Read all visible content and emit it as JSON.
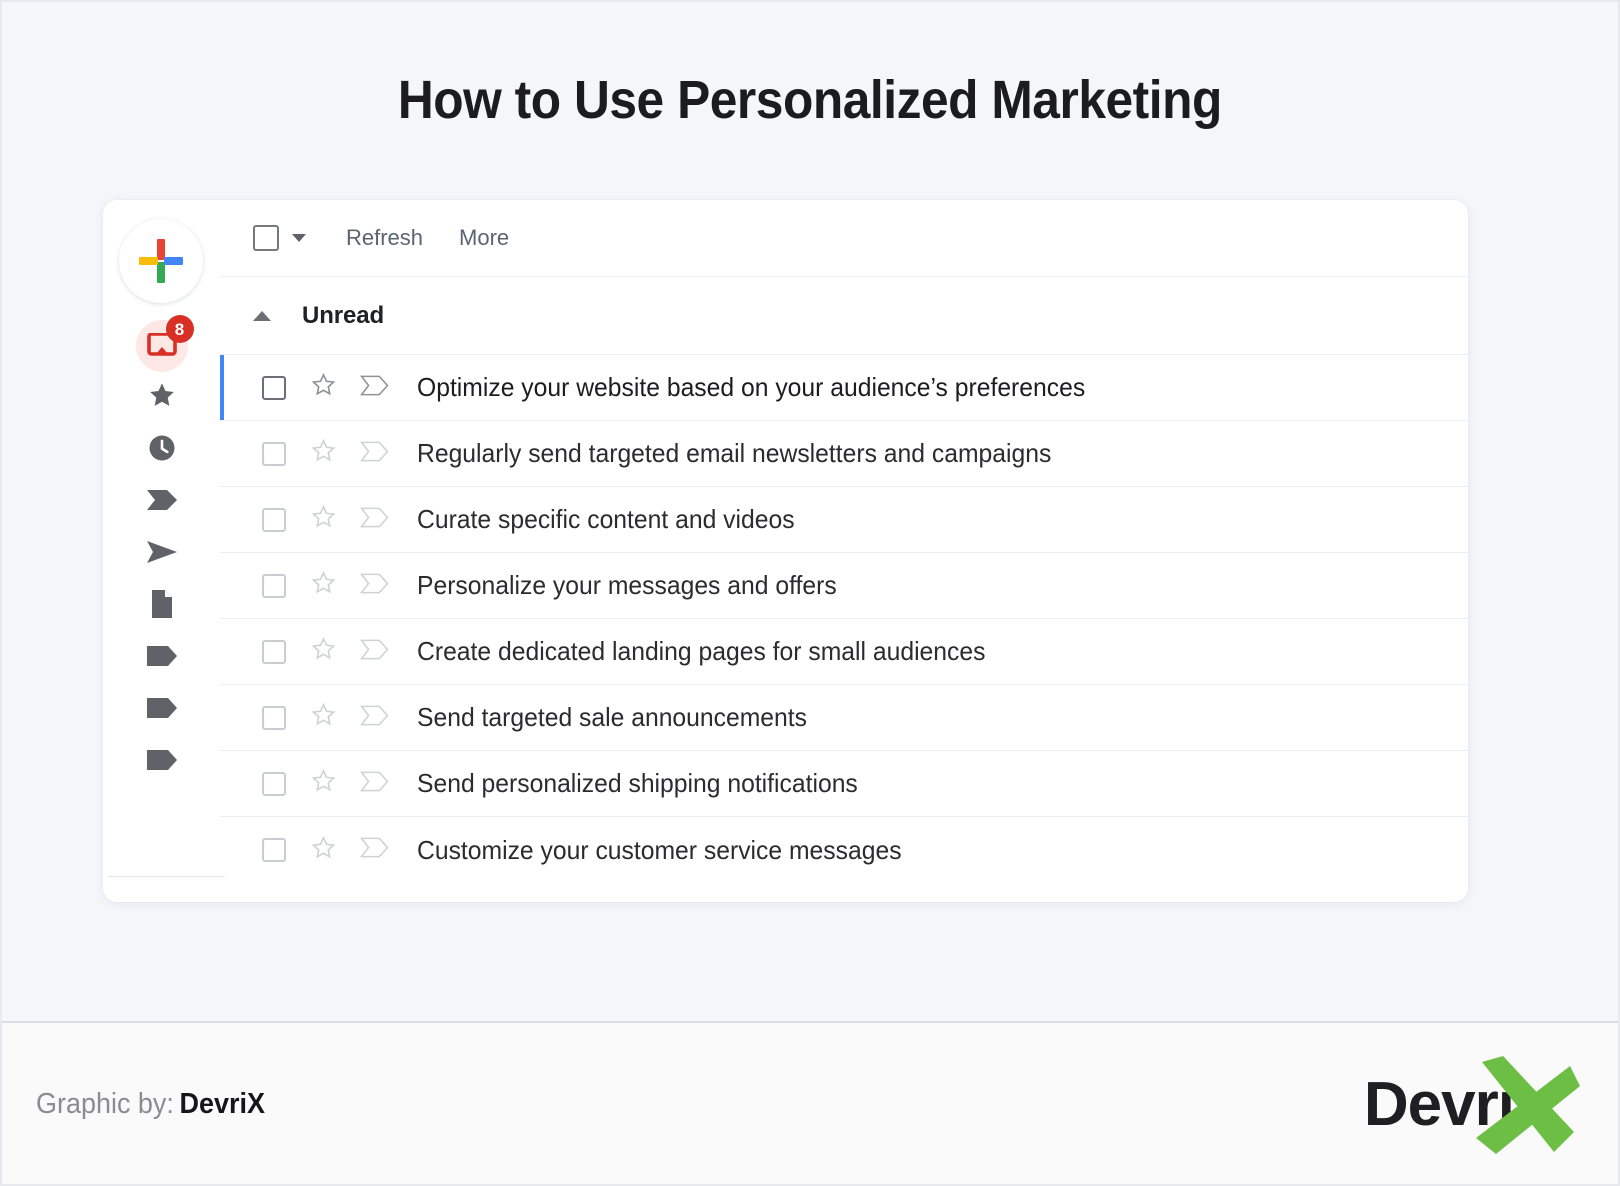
{
  "page": {
    "title": "How to Use Personalized Marketing",
    "background_color": "#F5F6FA",
    "card_background": "#FFFFFF"
  },
  "mail_app": {
    "compose": {
      "icon": "google-plus-icon",
      "label": ""
    },
    "rail_items": [
      {
        "icon": "inbox-icon",
        "name": "Inbox",
        "badge": "8",
        "color": "#D93025",
        "active": true
      },
      {
        "icon": "star-icon",
        "name": "Starred",
        "badge": "",
        "color": "#5F6368",
        "active": false
      },
      {
        "icon": "clock-icon",
        "name": "Snoozed",
        "badge": "",
        "color": "#5F6368",
        "active": false
      },
      {
        "icon": "label-chevron-icon",
        "name": "Important",
        "badge": "",
        "color": "#5F6368",
        "active": false
      },
      {
        "icon": "send-icon",
        "name": "Sent",
        "badge": "",
        "color": "#5F6368",
        "active": false
      },
      {
        "icon": "draft-icon",
        "name": "Drafts",
        "badge": "",
        "color": "#5F6368",
        "active": false
      },
      {
        "icon": "tag-icon",
        "name": "Category 1",
        "badge": "",
        "color": "#5F6368",
        "active": false
      },
      {
        "icon": "tag-icon",
        "name": "Category 2",
        "badge": "",
        "color": "#5F6368",
        "active": false
      },
      {
        "icon": "tag-icon",
        "name": "Category 3",
        "badge": "",
        "color": "#5F6368",
        "active": false
      }
    ],
    "toolbar": {
      "select_all_checkbox": "",
      "dropdown_caret": "",
      "refresh_label": "Refresh",
      "more_label": "More"
    },
    "section": {
      "collapse_icon": "chevron-up-icon",
      "label": "Unread"
    },
    "messages": [
      {
        "subject": "Optimize your website based on your audience’s preferences",
        "unread": true
      },
      {
        "subject": "Regularly send targeted email newsletters and campaigns",
        "unread": false
      },
      {
        "subject": "Curate specific content and videos",
        "unread": false
      },
      {
        "subject": "Personalize your messages and offers",
        "unread": false
      },
      {
        "subject": "Create dedicated landing pages for small audiences",
        "unread": false
      },
      {
        "subject": "Send targeted sale announcements",
        "unread": false
      },
      {
        "subject": "Send personalized shipping notifications",
        "unread": false
      },
      {
        "subject": "Customize your customer service messages",
        "unread": false
      }
    ]
  },
  "footer": {
    "credit_prefix": "Graphic by:",
    "credit_brand": "DevriX",
    "logo_word": "Devri",
    "logo_mark": "X",
    "logo_accent_color": "#6CBE45"
  }
}
